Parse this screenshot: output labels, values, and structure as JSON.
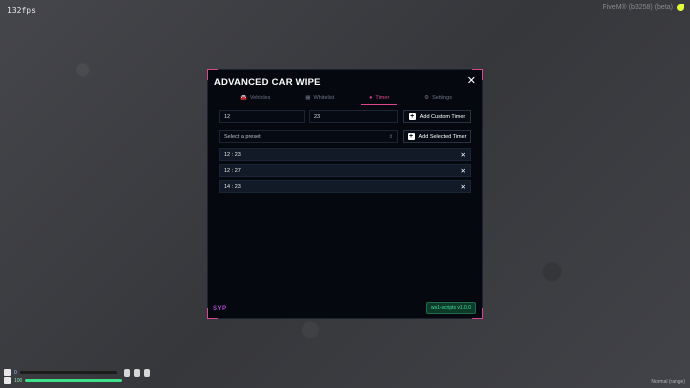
{
  "overlay": {
    "fps": "132fps",
    "fivem_label": "FiveM® (b3258) (beta)",
    "mode_label": "Normal (range)"
  },
  "window": {
    "title": "ADVANCED CAR WIPE",
    "close_glyph": "✕",
    "tabs": [
      {
        "label": "Vehicles",
        "icon": "car-icon",
        "glyph": "🚘",
        "active": false
      },
      {
        "label": "Whitelist",
        "icon": "list-icon",
        "glyph": "▦",
        "active": false
      },
      {
        "label": "Timer",
        "icon": "timer-icon",
        "glyph": "●",
        "active": true
      },
      {
        "label": "Settings",
        "icon": "gear-icon",
        "glyph": "⚙",
        "active": false
      }
    ],
    "hour_value": "12",
    "minute_value": "23",
    "add_custom_label": "Add Custom Timer",
    "preset_placeholder": "Select a preset",
    "add_selected_label": "Add Selected Timer",
    "timers": [
      {
        "time": "12 : 23"
      },
      {
        "time": "12 : 27"
      },
      {
        "time": "14 : 23"
      }
    ],
    "brand_logo": "SYP",
    "version": "ws1-scripts v1.0.0",
    "accent_color": "#e0468f"
  },
  "hud": {
    "armor_value": "0",
    "health_value": "100",
    "health_level": 1.0,
    "armor_level": 0.0
  }
}
